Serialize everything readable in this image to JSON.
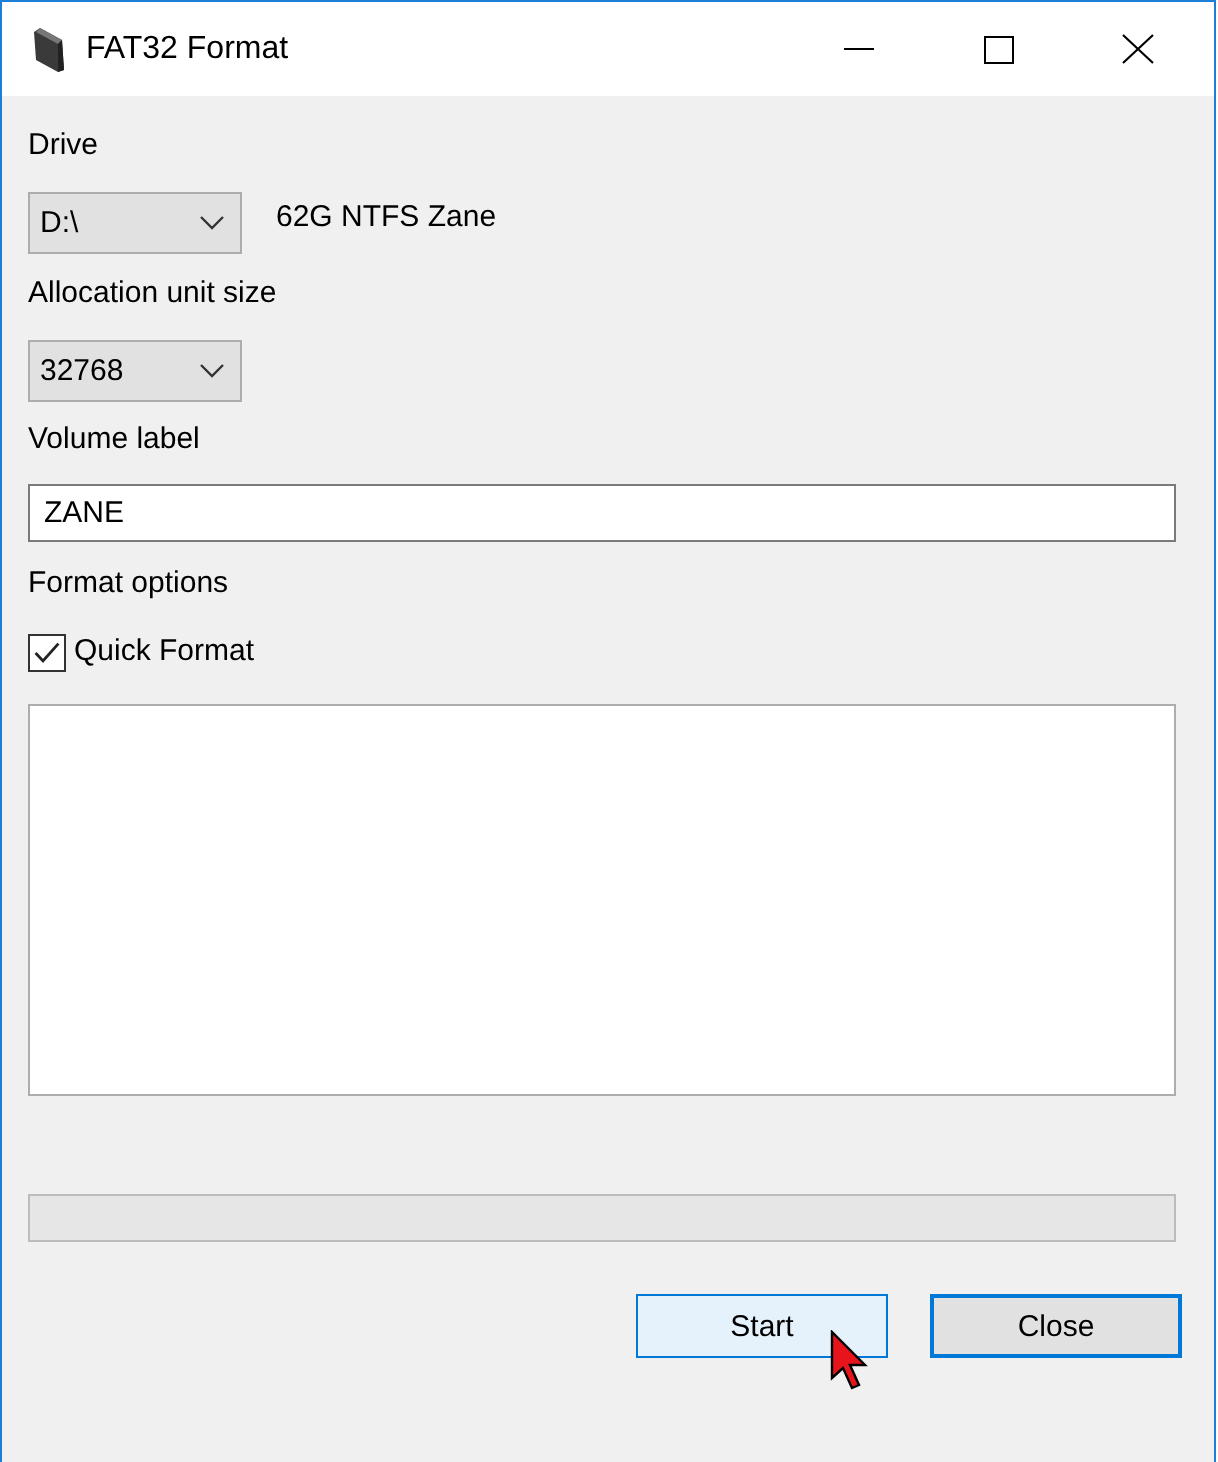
{
  "window": {
    "title": "FAT32 Format"
  },
  "drive": {
    "label": "Drive",
    "value": "D:\\",
    "info": "62G NTFS Zane"
  },
  "allocation_unit_size": {
    "label": "Allocation unit size",
    "value": "32768"
  },
  "volume_label": {
    "label": "Volume label",
    "value": "ZANE"
  },
  "format_options": {
    "label": "Format options",
    "quick_format": {
      "label": "Quick Format",
      "checked": true
    }
  },
  "progress": {
    "level": 0
  },
  "buttons": [
    {
      "label": "Start",
      "kind": "hover"
    },
    {
      "label": "Close",
      "kind": "default"
    }
  ]
}
